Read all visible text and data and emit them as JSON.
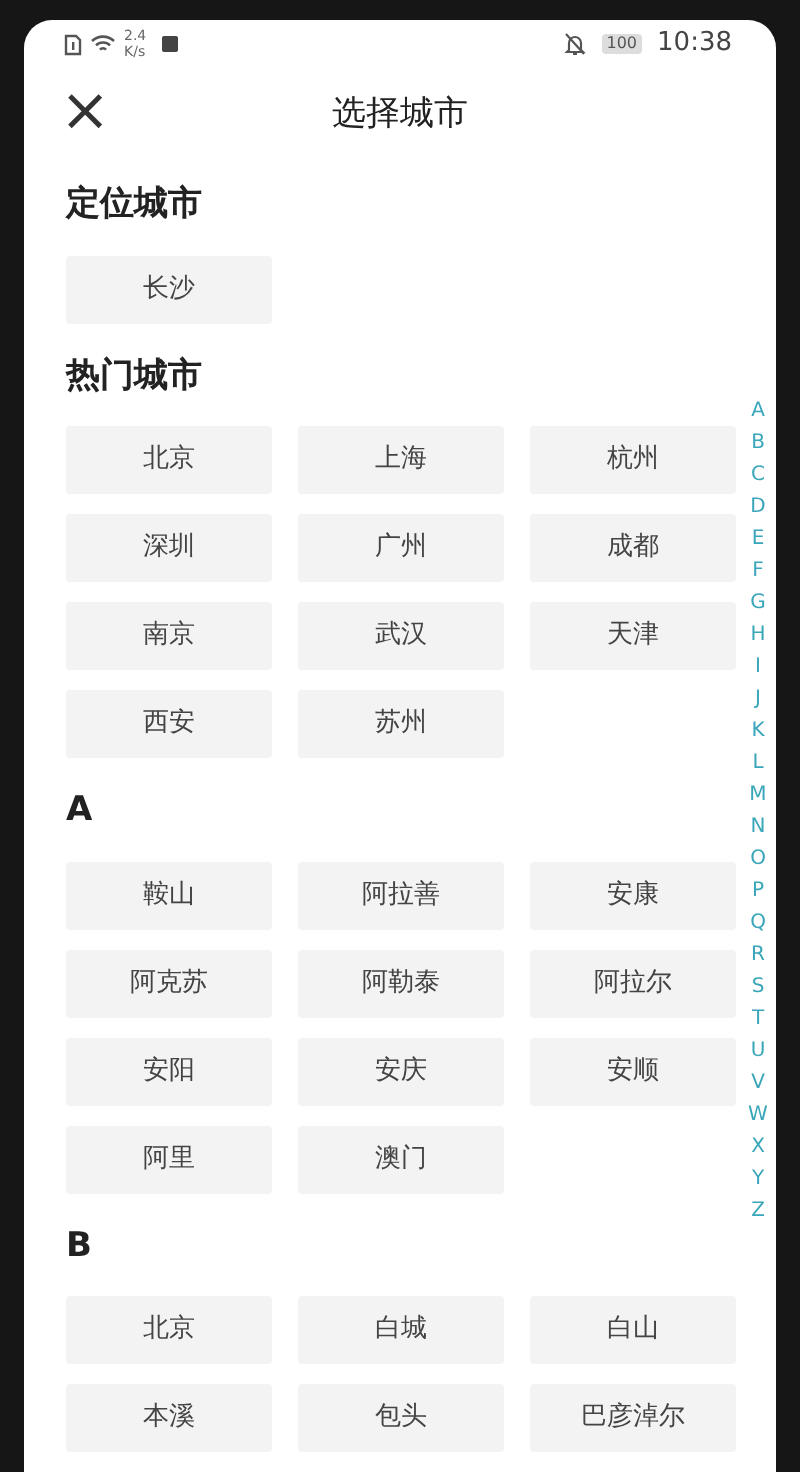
{
  "status_bar": {
    "speed_value": "2.4",
    "speed_unit": "K/s",
    "battery": "100",
    "time": "10:38"
  },
  "header": {
    "close": "×",
    "title": "选择城市"
  },
  "sections": [
    {
      "title": "定位城市",
      "cities": [
        "长沙"
      ]
    },
    {
      "title": "热门城市",
      "cities": [
        "北京",
        "上海",
        "杭州",
        "深圳",
        "广州",
        "成都",
        "南京",
        "武汉",
        "天津",
        "西安",
        "苏州"
      ]
    },
    {
      "title": "A",
      "cities": [
        "鞍山",
        "阿拉善",
        "安康",
        "阿克苏",
        "阿勒泰",
        "阿拉尔",
        "安阳",
        "安庆",
        "安顺",
        "阿里",
        "澳门"
      ]
    },
    {
      "title": "B",
      "cities": [
        "北京",
        "白城",
        "白山",
        "本溪",
        "包头",
        "巴彦淖尔"
      ]
    }
  ],
  "index_letters": [
    "A",
    "B",
    "C",
    "D",
    "E",
    "F",
    "G",
    "H",
    "I",
    "J",
    "K",
    "L",
    "M",
    "N",
    "O",
    "P",
    "Q",
    "R",
    "S",
    "T",
    "U",
    "V",
    "W",
    "X",
    "Y",
    "Z"
  ]
}
